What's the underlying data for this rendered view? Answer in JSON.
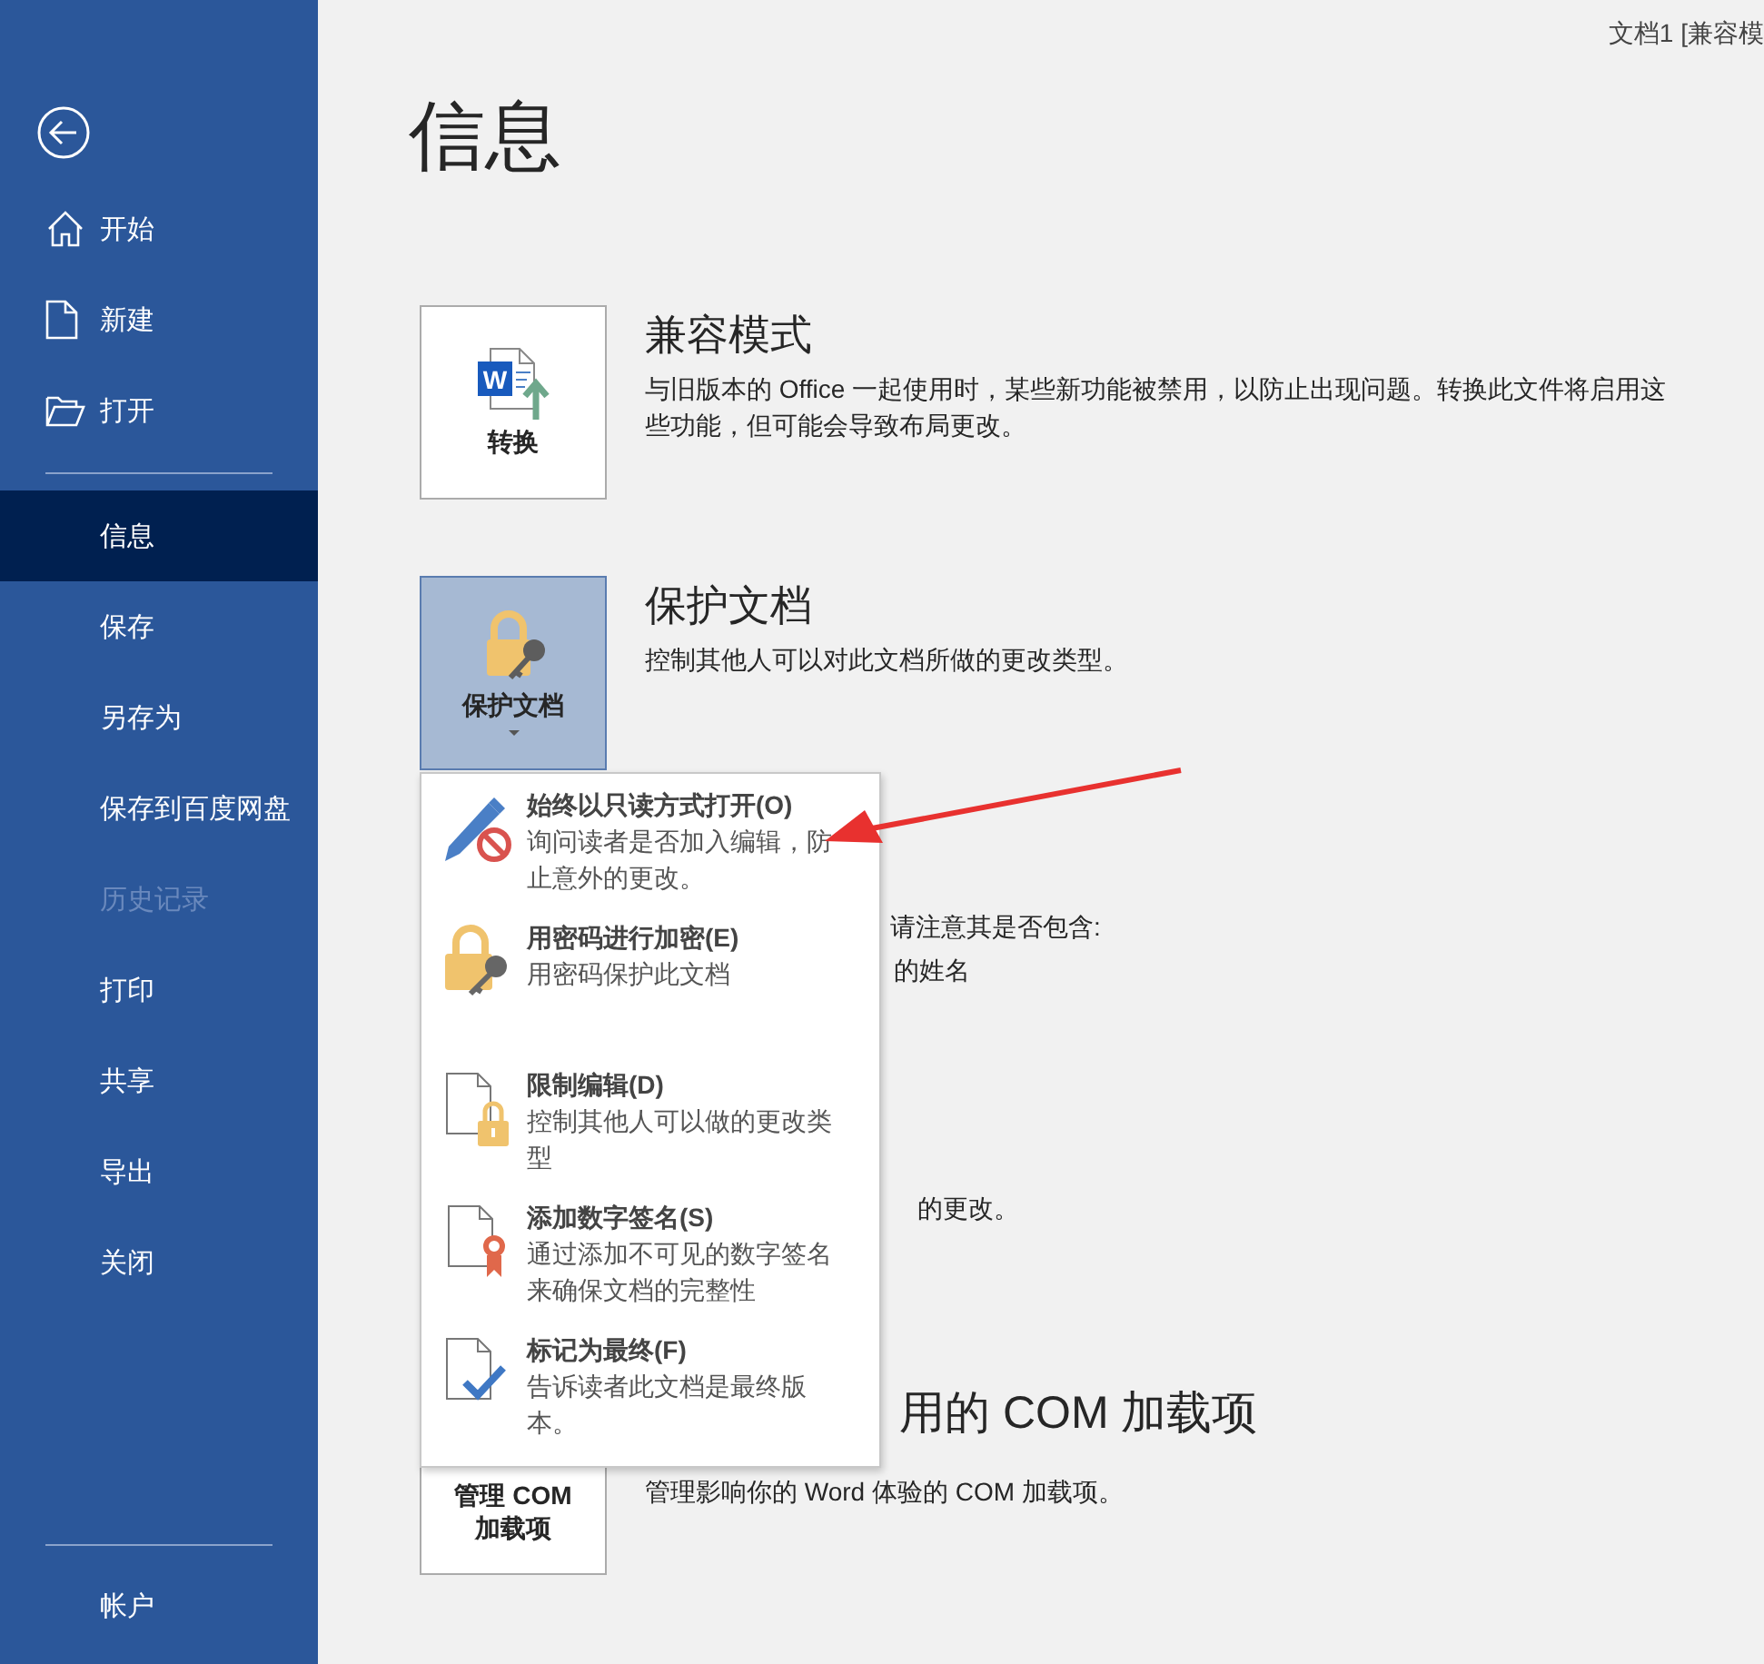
{
  "title_bar": {
    "title": "文档1 [兼容模"
  },
  "sidebar": {
    "nav_items": [
      {
        "label": "开始",
        "selected": false
      },
      {
        "label": "新建",
        "selected": false
      },
      {
        "label": "打开",
        "selected": false
      }
    ],
    "items": [
      {
        "label": "信息",
        "selected": true,
        "disabled": false
      },
      {
        "label": "保存",
        "selected": false,
        "disabled": false
      },
      {
        "label": "另存为",
        "selected": false,
        "disabled": false
      },
      {
        "label": "保存到百度网盘",
        "selected": false,
        "disabled": false
      },
      {
        "label": "历史记录",
        "selected": false,
        "disabled": true
      },
      {
        "label": "打印",
        "selected": false,
        "disabled": false
      },
      {
        "label": "共享",
        "selected": false,
        "disabled": false
      },
      {
        "label": "导出",
        "selected": false,
        "disabled": false
      },
      {
        "label": "关闭",
        "selected": false,
        "disabled": false
      }
    ],
    "footer_items": [
      {
        "label": "帐户",
        "selected": false,
        "disabled": false
      }
    ]
  },
  "main": {
    "page_title": "信息",
    "sections": [
      {
        "kind": "compat",
        "icon_letter": "W",
        "button_label": "转换",
        "pressed": false,
        "heading": "兼容模式",
        "description": "与旧版本的 Office 一起使用时，某些新功能被禁用，以防止出现问题。转换此文件将启用这些功能，但可能会导致布局更改。"
      },
      {
        "kind": "protect",
        "button_label": "保护文档",
        "pressed": true,
        "heading": "保护文档",
        "description": "控制其他人可以对此文档所做的更改类型。"
      },
      {
        "kind": "partial",
        "texts": [
          "请注意其是否包含:",
          "的姓名",
          "的更改。"
        ]
      },
      {
        "kind": "com",
        "button_label": "管理 COM 加载项",
        "pressed": false,
        "heading": "用的 COM 加载项",
        "description": "管理影响你的 Word 体验的 COM 加载项。"
      }
    ]
  },
  "protect_menu": {
    "items": [
      {
        "title": "始终以只读方式打开(O)",
        "description": "询问读者是否加入编辑，防止意外的更改。"
      },
      {
        "title": "用密码进行加密(E)",
        "description": "用密码保护此文档"
      },
      {
        "title": "限制编辑(D)",
        "description": "控制其他人可以做的更改类型"
      },
      {
        "title": "添加数字签名(S)",
        "description": "通过添加不可见的数字签名来确保文档的完整性"
      },
      {
        "title": "标记为最终(F)",
        "description": "告诉读者此文档是最终版本。"
      }
    ]
  }
}
